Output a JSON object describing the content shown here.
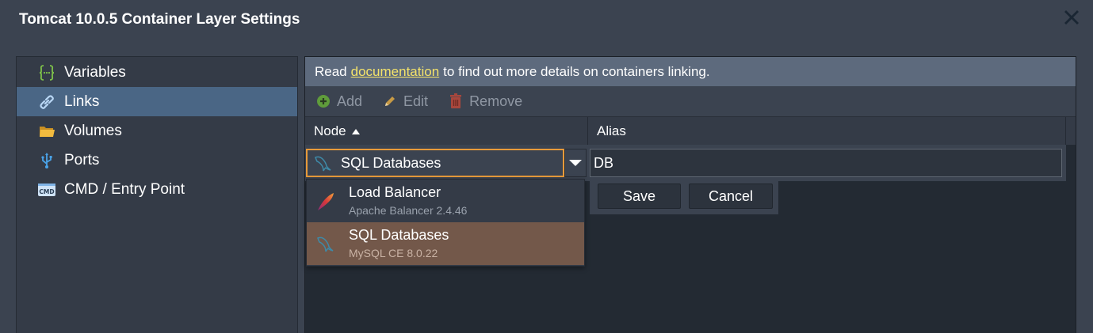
{
  "window": {
    "title": "Tomcat 10.0.5 Container Layer Settings",
    "close_icon": "close-icon"
  },
  "sidebar": {
    "items": [
      {
        "label": "Variables",
        "icon": "variables-icon",
        "active": false
      },
      {
        "label": "Links",
        "icon": "link-icon",
        "active": true
      },
      {
        "label": "Volumes",
        "icon": "folder-icon",
        "active": false
      },
      {
        "label": "Ports",
        "icon": "usb-icon",
        "active": false
      },
      {
        "label": "CMD / Entry Point",
        "icon": "cmd-icon",
        "active": false
      }
    ]
  },
  "info": {
    "before": "Read",
    "link": "documentation",
    "after": "to find out more details on containers linking."
  },
  "toolbar": {
    "add_label": "Add",
    "edit_label": "Edit",
    "remove_label": "Remove"
  },
  "grid": {
    "columns": [
      "Node",
      "Alias"
    ],
    "sort_column": "Node",
    "sort_direction": "ascending"
  },
  "editor": {
    "node_value": "SQL Databases",
    "alias_value": "DB",
    "save_label": "Save",
    "cancel_label": "Cancel"
  },
  "dropdown": {
    "options": [
      {
        "name": "Load Balancer",
        "detail": "Apache Balancer 2.4.46",
        "icon": "apache-feather-icon"
      },
      {
        "name": "SQL Databases",
        "detail": "MySQL CE 8.0.22",
        "icon": "mysql-dolphin-icon"
      }
    ],
    "selected": "SQL Databases"
  },
  "colors": {
    "accent_focus": "#e79a3a",
    "active_item": "#4a6685",
    "selected_option": "#73584a",
    "link": "#f4e36a"
  }
}
